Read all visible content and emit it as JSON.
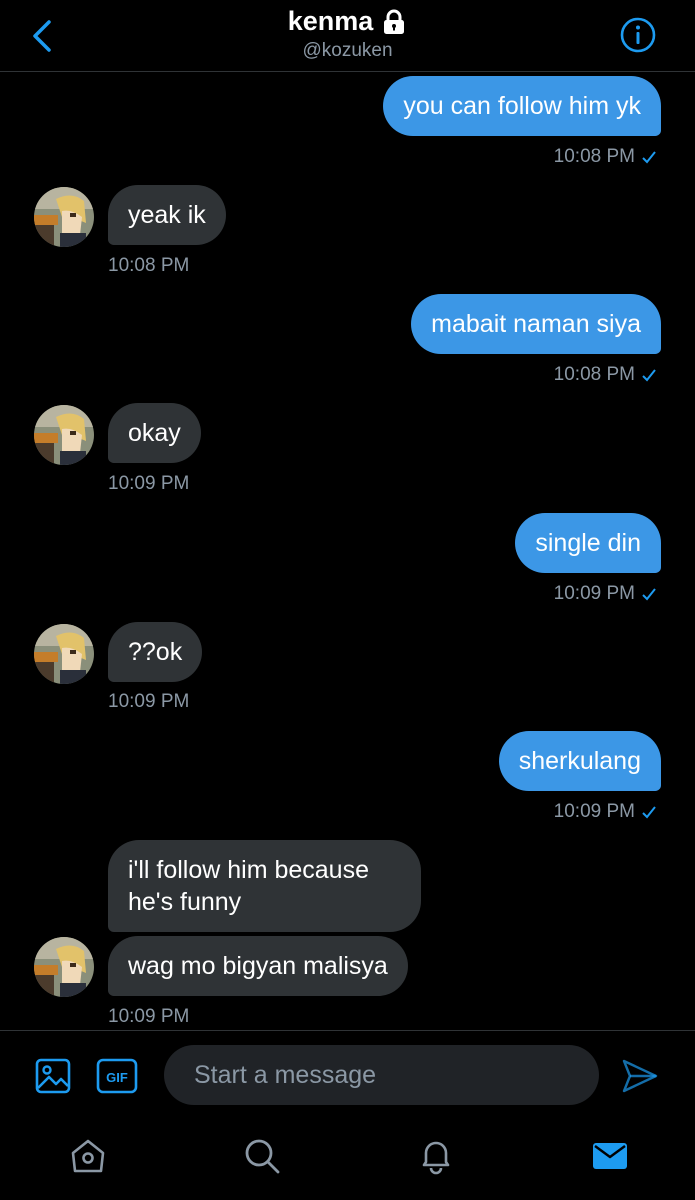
{
  "header": {
    "title": "kenma",
    "handle": "@kozuken",
    "icons": {
      "back": "chevron-left-icon",
      "lock": "lock-icon",
      "info": "info-icon"
    }
  },
  "messages": [
    {
      "direction": "out",
      "text": "you can follow him yk",
      "time": "10:08 PM",
      "read": true
    },
    {
      "direction": "in",
      "text": "yeak ik",
      "time": "10:08 PM"
    },
    {
      "direction": "out",
      "text": "mabait naman siya",
      "time": "10:08 PM",
      "read": true
    },
    {
      "direction": "in",
      "text": "okay",
      "time": "10:09 PM"
    },
    {
      "direction": "out",
      "text": "single din",
      "time": "10:09 PM",
      "read": true
    },
    {
      "direction": "in",
      "text": "??ok",
      "time": "10:09 PM"
    },
    {
      "direction": "out",
      "text": "sherkulang",
      "time": "10:09 PM",
      "read": true
    },
    {
      "direction": "in",
      "text": "i'll follow him because he's funny"
    },
    {
      "direction": "in",
      "text": "wag mo bigyan malisya",
      "time": "10:09 PM"
    }
  ],
  "composer": {
    "placeholder": "Start a message",
    "icons": {
      "media": "image-icon",
      "gif": "gif-icon",
      "send": "send-icon"
    },
    "gif_label": "GIF"
  },
  "nav": {
    "items": [
      "home-icon",
      "search-icon",
      "notifications-bell-icon",
      "messages-envelope-icon"
    ],
    "active": "messages-envelope-icon"
  },
  "colors": {
    "accent": "#1d9bf0",
    "outgoing_bubble": "#3c97e6",
    "incoming_bubble": "#2f3336",
    "muted_text": "#8b98a5",
    "background": "#000000"
  }
}
